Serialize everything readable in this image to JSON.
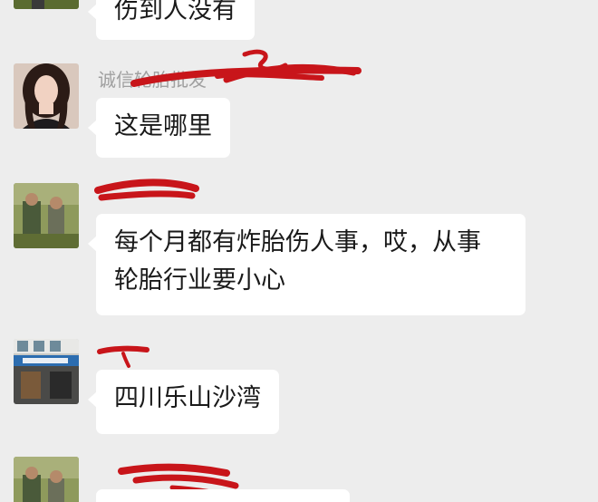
{
  "messages": [
    {
      "sender": "",
      "lines": [
        "伤到人没有"
      ]
    },
    {
      "sender": "诚信轮胎批发",
      "lines": [
        "这是哪里"
      ]
    },
    {
      "sender": "",
      "lines": [
        "每个月都有炸胎伤人事，哎，从事",
        "轮胎行业要小心"
      ]
    },
    {
      "sender": "",
      "lines": [
        "四川乐山沙湾"
      ]
    },
    {
      "sender": "",
      "lines": [
        ""
      ]
    }
  ],
  "colors": {
    "background": "#ededed",
    "bubble": "#ffffff",
    "sender_name": "#a0a0a0",
    "redaction": "#c8151a"
  }
}
